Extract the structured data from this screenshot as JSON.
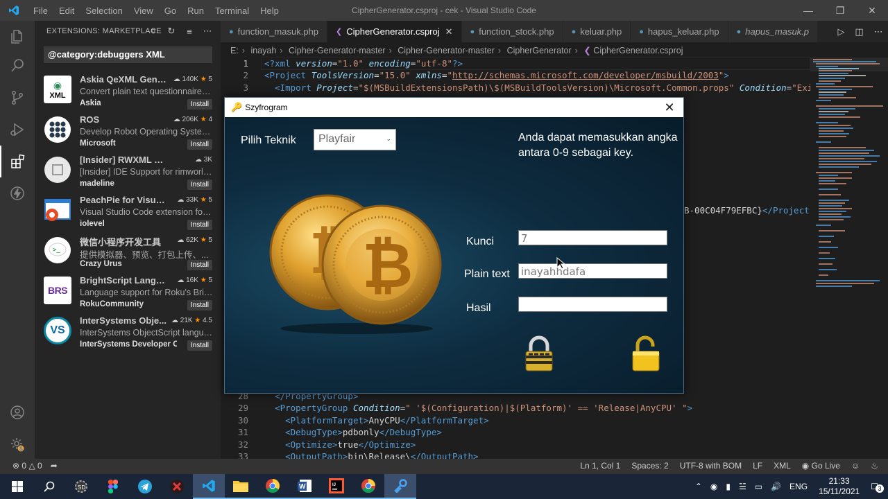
{
  "window": {
    "title": "CipherGenerator.csproj - cek - Visual Studio Code",
    "menu": [
      "File",
      "Edit",
      "Selection",
      "View",
      "Go",
      "Run",
      "Terminal",
      "Help"
    ]
  },
  "sidebar": {
    "title": "EXTENSIONS: MARKETPLACE",
    "search_value": "@category:debuggers XML",
    "extensions": [
      {
        "name": "Askia QeXML Gene...",
        "downloads": "140K",
        "rating": "5",
        "description": "Convert plain text questionnaires ...",
        "author": "Askia",
        "install": "Install",
        "icon": "xml-file-icon",
        "icon_text": "XML"
      },
      {
        "name": "ROS",
        "downloads": "206K",
        "rating": "4",
        "description": "Develop Robot Operating System...",
        "author": "Microsoft",
        "install": "Install",
        "icon": "ros-dots-icon",
        "icon_text": ""
      },
      {
        "name": "[Insider] RWXML Langu...",
        "downloads": "3K",
        "rating": "",
        "description": "[Insider] IDE Support for rimworld...",
        "author": "madeline",
        "install": "Install",
        "icon": "rwxml-icon",
        "icon_text": ""
      },
      {
        "name": "PeachPie for Visual ...",
        "downloads": "33K",
        "rating": "5",
        "description": "Visual Studio Code extension for ...",
        "author": "iolevel",
        "install": "Install",
        "icon": "peachpie-icon",
        "icon_text": ""
      },
      {
        "name": "微信小程序开发工具",
        "downloads": "62K",
        "rating": "5",
        "description": "提供模拟器、预览、打包上传、...",
        "author": "Crazy Urus",
        "install": "Install",
        "icon": "wechat-icon",
        "icon_text": ""
      },
      {
        "name": "BrightScript Langua...",
        "downloads": "16K",
        "rating": "5",
        "description": "Language support for Roku's Brig...",
        "author": "RokuCommunity",
        "install": "Install",
        "icon": "brs-icon",
        "icon_text": "BRS"
      },
      {
        "name": "InterSystems Obje...",
        "downloads": "21K",
        "rating": "4.5",
        "description": "InterSystems ObjectScript langua...",
        "author": "InterSystems Developer Co...",
        "install": "Install",
        "icon": "intersystems-icon",
        "icon_text": "VS"
      }
    ]
  },
  "tabs": [
    {
      "label": "function_masuk.php",
      "active": false,
      "icon": "php-icon"
    },
    {
      "label": "CipherGenerator.csproj",
      "active": true,
      "icon": "msbuild-icon"
    },
    {
      "label": "function_stock.php",
      "active": false,
      "icon": "php-icon"
    },
    {
      "label": "keluar.php",
      "active": false,
      "icon": "php-icon"
    },
    {
      "label": "hapus_keluar.php",
      "active": false,
      "icon": "php-icon"
    },
    {
      "label": "hapus_masuk.p",
      "active": false,
      "icon": "php-icon"
    }
  ],
  "breadcrumb": [
    "E:",
    "inayah",
    "Cipher-Generator-master",
    "Cipher-Generator-master",
    "CipherGenerator",
    "CipherGenerator.csproj"
  ],
  "code": {
    "top_lines": [
      {
        "num": "1",
        "text": "<?xml version=\"1.0\" encoding=\"utf-8\"?>"
      },
      {
        "num": "2",
        "text": "<Project ToolsVersion=\"15.0\" xmlns=\"http://schemas.microsoft.com/developer/msbuild/2003\">"
      },
      {
        "num": "3",
        "text": "  <Import Project=\"$(MSBuildExtensionsPath)\\$(MSBuildToolsVersion)\\Microsoft.Common.props\" Condition=\"Exists"
      }
    ],
    "partial_line": "B-00C04F79EFBC}</Project",
    "bottom_lines": [
      {
        "num": "28",
        "text": "  </PropertyGroup>"
      },
      {
        "num": "29",
        "text": "  <PropertyGroup Condition=\" '$(Configuration)|$(Platform)' == 'Release|AnyCPU' \">"
      },
      {
        "num": "30",
        "text": "    <PlatformTarget>AnyCPU</PlatformTarget>"
      },
      {
        "num": "31",
        "text": "    <DebugType>pdbonly</DebugType>"
      },
      {
        "num": "32",
        "text": "    <Optimize>true</Optimize>"
      },
      {
        "num": "33",
        "text": "    <OutputPath>bin\\Release\\</OutputPath>"
      }
    ]
  },
  "statusbar": {
    "errors": "0",
    "warnings": "0",
    "position": "Ln 1, Col 1",
    "spaces": "Spaces: 2",
    "encoding": "UTF-8 with BOM",
    "eol": "LF",
    "language": "XML",
    "golive": "Go Live"
  },
  "dialog": {
    "title": "Szyfrogram",
    "pilih_label": "Pilih Teknik",
    "teknik_value": "Playfair",
    "hint": "Anda dapat memasukkan angka antara 0-9 sebagai key.",
    "kunci_label": "Kunci",
    "kunci_value": "7",
    "plain_label": "Plain text",
    "plain_value": "inayahhdafa",
    "hasil_label": "Hasil",
    "hasil_value": ""
  },
  "taskbar": {
    "apps": [
      "start-icon",
      "search-icon",
      "sd-app-icon",
      "figma-icon",
      "telegram-icon",
      "game-app-icon",
      "vscode-icon",
      "file-explorer-icon",
      "chrome-icon",
      "word-icon",
      "intellij-icon",
      "chrome-alt-icon",
      "szyfrogram-app-icon"
    ],
    "lang": "ENG",
    "time": "21:33",
    "date": "15/11/2021",
    "notifications": "3"
  },
  "colors": {
    "accent": "#007acc",
    "dialog_bg": "#0f2a3c",
    "coin_gold": "#d89a2a"
  }
}
